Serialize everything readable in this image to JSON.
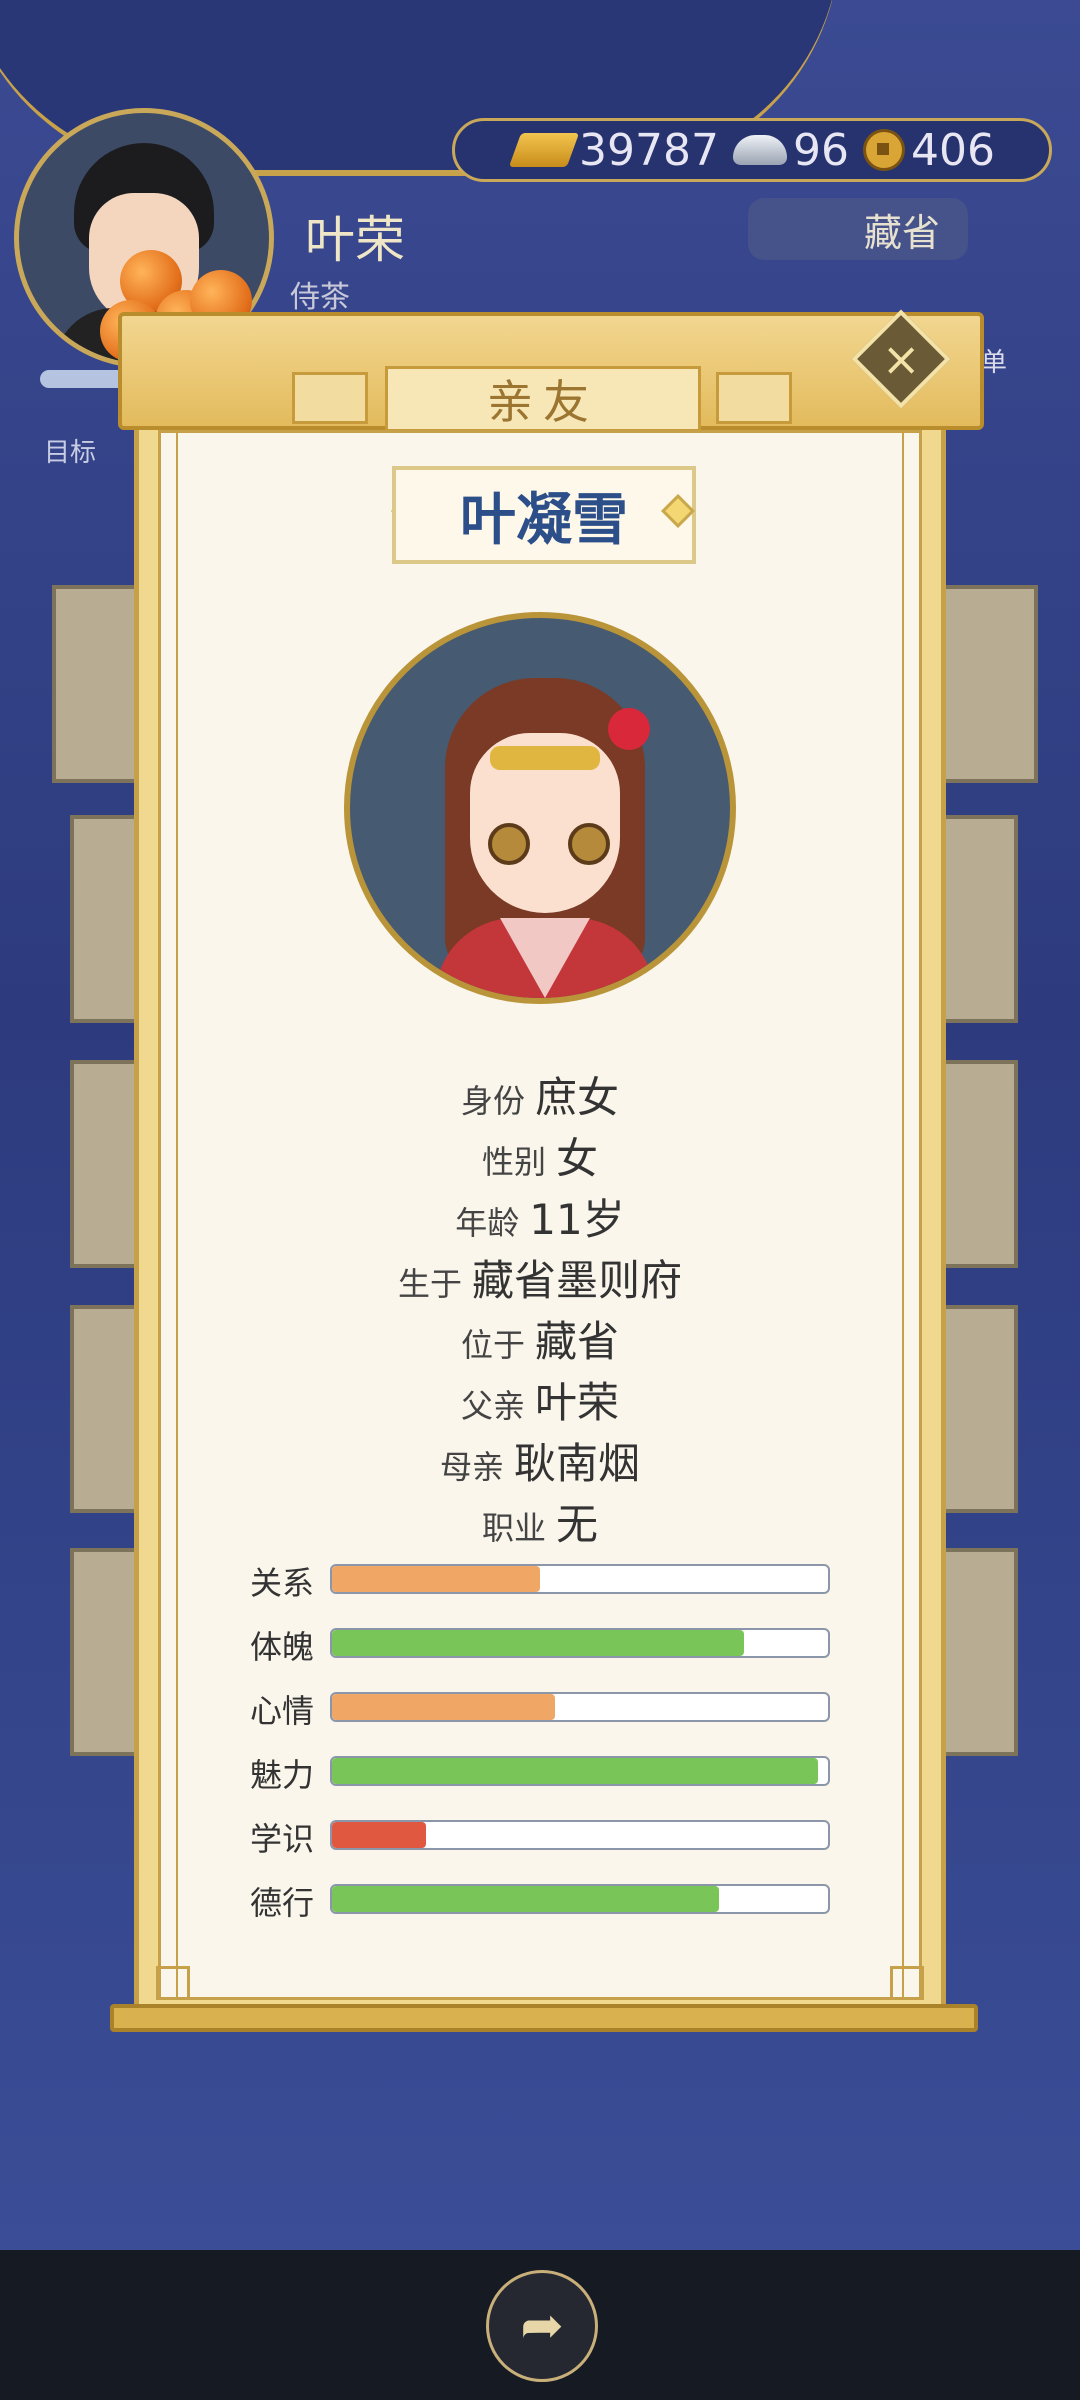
{
  "player": {
    "name": "叶荣",
    "title": "侍茶",
    "target_label": "目标"
  },
  "currency": {
    "gold": "39787",
    "silver": "96",
    "coin": "406"
  },
  "location_button": "藏省",
  "menu_label": "菜单",
  "modal": {
    "title": "亲友",
    "close_icon": "close-icon",
    "character": {
      "name": "叶凝雪",
      "info": [
        {
          "key": "身份",
          "value": "庶女"
        },
        {
          "key": "性别",
          "value": "女"
        },
        {
          "key": "年龄",
          "value": "11岁"
        },
        {
          "key": "生于",
          "value": "藏省墨则府"
        },
        {
          "key": "位于",
          "value": "藏省"
        },
        {
          "key": "父亲",
          "value": "叶荣"
        },
        {
          "key": "母亲",
          "value": "耿南烟"
        },
        {
          "key": "职业",
          "value": "无"
        }
      ],
      "stats": [
        {
          "label": "关系",
          "percent": 42,
          "color": "#f0a766"
        },
        {
          "label": "体魄",
          "percent": 83,
          "color": "#7ac558"
        },
        {
          "label": "心情",
          "percent": 45,
          "color": "#f0a766"
        },
        {
          "label": "魅力",
          "percent": 98,
          "color": "#7ac558"
        },
        {
          "label": "学识",
          "percent": 19,
          "color": "#e0583f"
        },
        {
          "label": "德行",
          "percent": 78,
          "color": "#7ac558"
        }
      ]
    }
  },
  "share_icon": "share-icon"
}
